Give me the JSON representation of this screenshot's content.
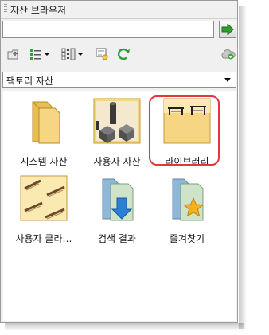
{
  "window": {
    "title": "자산 브라우저"
  },
  "search": {
    "value": "",
    "placeholder": ""
  },
  "toolbar": {
    "buttons": [
      {
        "icon": "folder-up-icon"
      },
      {
        "icon": "list-view-icon",
        "dropdown": true
      },
      {
        "icon": "view-options-icon",
        "dropdown": true
      },
      {
        "icon": "preview-icon"
      },
      {
        "icon": "refresh-icon"
      },
      {
        "icon": "cloud-sync-icon"
      }
    ]
  },
  "category": {
    "selected": "팩토리 자산"
  },
  "items": [
    {
      "label": "시스템 자산",
      "icon": "system-folder-icon",
      "selected": false
    },
    {
      "label": "사용자 자산",
      "icon": "user-assets-folder-icon",
      "selected": false
    },
    {
      "label": "라이브러리",
      "icon": "library-folder-icon",
      "selected": true
    },
    {
      "label": "사용자 클라…",
      "icon": "user-client-folder-icon",
      "selected": false
    },
    {
      "label": "검색 결과",
      "icon": "search-results-folder-icon",
      "selected": false
    },
    {
      "label": "즐겨찾기",
      "icon": "favorites-folder-icon",
      "selected": false
    }
  ],
  "colors": {
    "highlight": "#e0383e",
    "folder": "#f2c75c",
    "go_button": "#2e9e2e"
  }
}
